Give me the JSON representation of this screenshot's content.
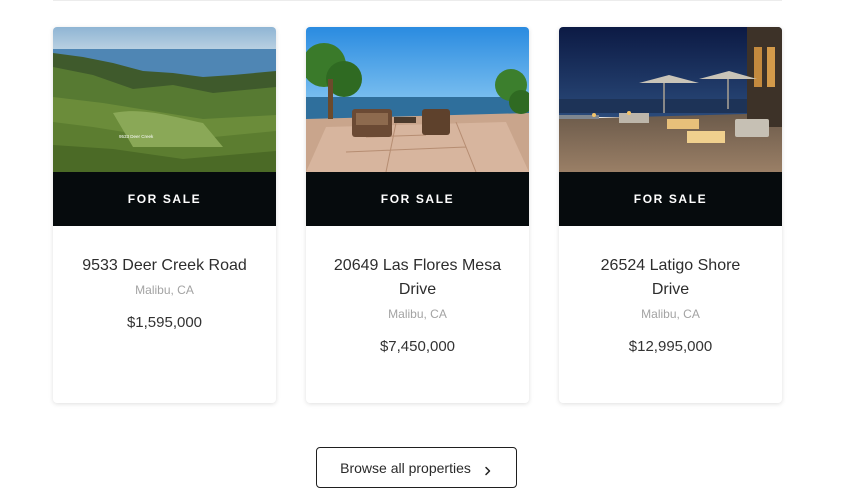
{
  "listings": [
    {
      "status": "FOR SALE",
      "address": "9533 Deer Creek Road",
      "city": "Malibu, CA",
      "price": "$1,595,000",
      "photo_label": "9533 Deer Creek"
    },
    {
      "status": "FOR SALE",
      "address": "20649 Las Flores Mesa Drive",
      "city": "Malibu, CA",
      "price": "$7,450,000"
    },
    {
      "status": "FOR SALE",
      "address": "26524 Latigo Shore Drive",
      "city": "Malibu, CA",
      "price": "$12,995,000"
    }
  ],
  "browse": {
    "label": "Browse all properties",
    "icon": "chevron-right-icon"
  },
  "colors": {
    "band": "#060b0d",
    "text": "#2d2d2d",
    "muted": "#a3a3a3"
  }
}
